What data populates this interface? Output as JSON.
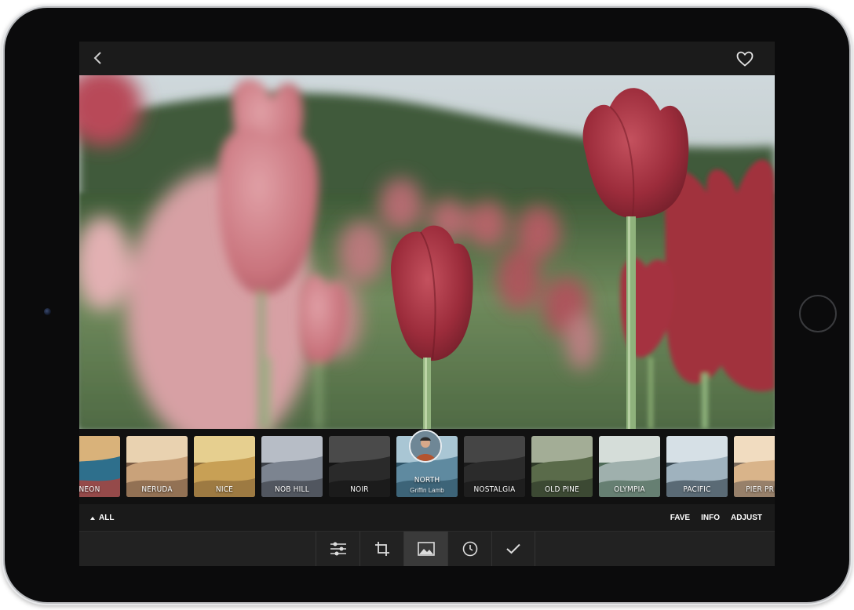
{
  "top_bar": {
    "back_icon": "chevron-left-icon",
    "favorite_icon": "heart-icon"
  },
  "filters": [
    {
      "name": "NEON",
      "palette": [
        "#2e6f8c",
        "#c23a2e",
        "#d9b27a"
      ]
    },
    {
      "name": "NERUDA",
      "palette": [
        "#c9a27a",
        "#7a5c45",
        "#e9d2b0"
      ]
    },
    {
      "name": "NICE",
      "palette": [
        "#c8a055",
        "#8a6a3a",
        "#e6cf8f"
      ]
    },
    {
      "name": "NOB HILL",
      "palette": [
        "#7c8490",
        "#3e434a",
        "#b7bdc6"
      ]
    },
    {
      "name": "NOIR",
      "palette": [
        "#2a2a2a",
        "#151515",
        "#4a4a4a"
      ]
    },
    {
      "name": "NORTH",
      "author": "Griffin Lamb",
      "palette": [
        "#5f8aa0",
        "#2f5467",
        "#a9c6d4"
      ]
    },
    {
      "name": "NOSTALGIA",
      "palette": [
        "#2b2b2b",
        "#1a1a1a",
        "#454545"
      ]
    },
    {
      "name": "OLD PINE",
      "palette": [
        "#5a6b4a",
        "#2f3a29",
        "#a3ad96"
      ]
    },
    {
      "name": "OLYMPIA",
      "palette": [
        "#9fb0ad",
        "#4f6b58",
        "#d5ddd9"
      ]
    },
    {
      "name": "PACIFIC",
      "palette": [
        "#9fb2be",
        "#3d4c55",
        "#d6e0e6"
      ]
    },
    {
      "name": "PIER PRES",
      "palette": [
        "#d9b48a",
        "#7a6a5c",
        "#f1dcc0"
      ]
    }
  ],
  "selected_filter": "NORTH",
  "options": {
    "all_label": "ALL",
    "fave_label": "FAVE",
    "info_label": "INFO",
    "adjust_label": "ADJUST"
  },
  "toolbar": [
    {
      "icon": "sliders-icon"
    },
    {
      "icon": "crop-icon"
    },
    {
      "icon": "image-icon",
      "active": true
    },
    {
      "icon": "history-icon"
    },
    {
      "icon": "checkmark-icon"
    }
  ]
}
